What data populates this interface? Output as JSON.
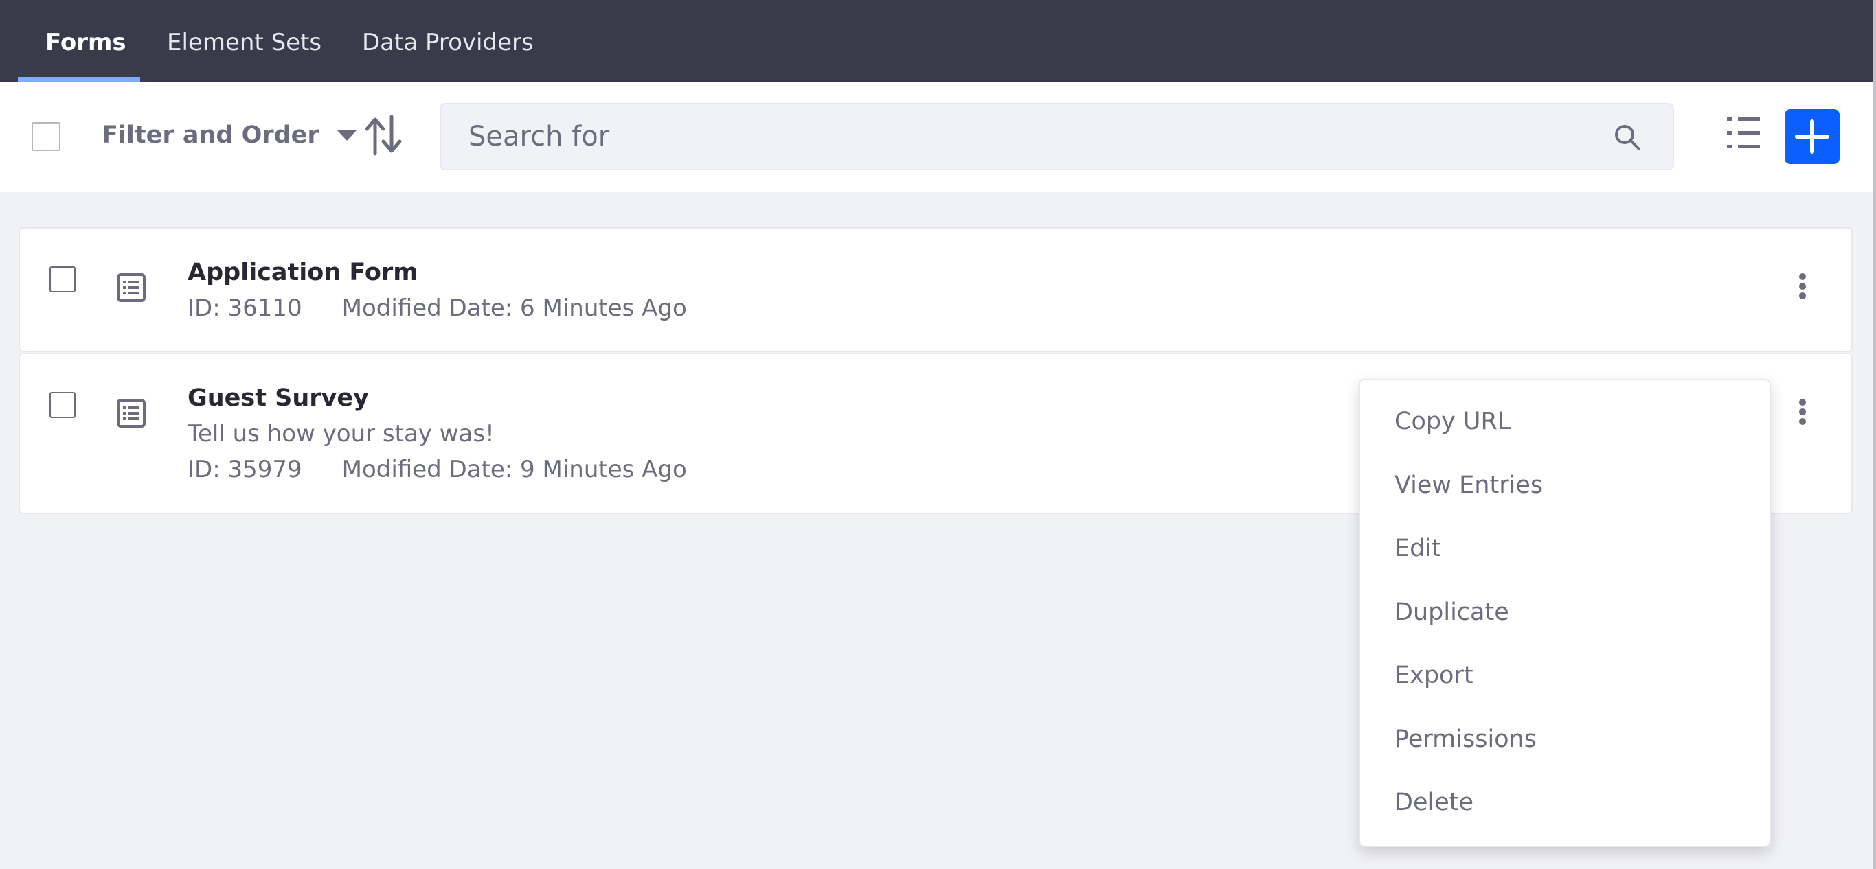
{
  "nav": {
    "tabs": [
      {
        "label": "Forms",
        "active": true
      },
      {
        "label": "Element Sets",
        "active": false
      },
      {
        "label": "Data Providers",
        "active": false
      }
    ]
  },
  "toolbar": {
    "filter_label": "Filter and Order",
    "search_placeholder": "Search for",
    "sort_icon": "sort-arrows-icon",
    "view_icon": "list-view-icon",
    "add_icon": "plus-icon"
  },
  "forms": [
    {
      "title": "Application Form",
      "description": "",
      "id": "ID: 36110",
      "modified": "Modified Date: 6 Minutes Ago"
    },
    {
      "title": "Guest Survey",
      "description": "Tell us how your stay was!",
      "id": "ID: 35979",
      "modified": "Modified Date: 9 Minutes Ago"
    }
  ],
  "menu": {
    "items": [
      "Copy URL",
      "View Entries",
      "Edit",
      "Duplicate",
      "Export",
      "Permissions",
      "Delete"
    ]
  },
  "colors": {
    "nav_bg": "#393a4a",
    "active_tab_underline": "#80acff",
    "primary": "#0b5fff",
    "page_bg": "#f1f2f5",
    "secondary_text": "#6b6c7e"
  }
}
